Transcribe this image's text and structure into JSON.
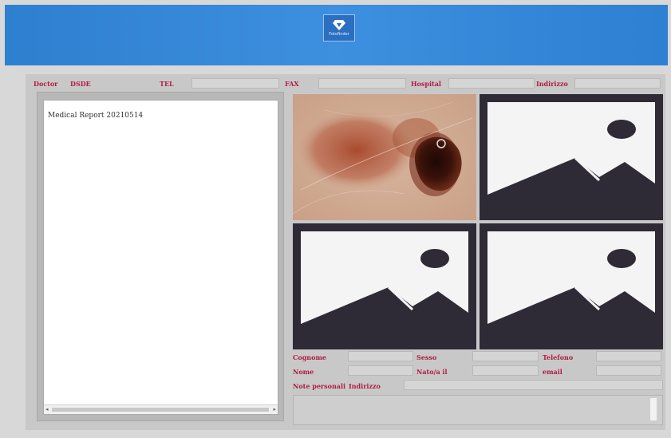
{
  "header": {
    "logo_caption": "Fotofinder"
  },
  "doctor_bar": {
    "doctor_label": "Doctor",
    "doctor_value": "DSDE",
    "tel_label": "TEL",
    "fax_label": "FAX",
    "hospital_label": "Hospital",
    "address_label": "Indirizzo"
  },
  "report": {
    "text": "Medical Report 20210514"
  },
  "images": [
    {
      "kind": "dermoscopy-photo"
    },
    {
      "kind": "placeholder-image"
    },
    {
      "kind": "placeholder-image"
    },
    {
      "kind": "placeholder-image"
    }
  ],
  "patient": {
    "cognome_label": "Cognome",
    "sesso_label": "Sesso",
    "telefono_label": "Telefono",
    "nome_label": "Nome",
    "nato_label": "Nato/a il",
    "email_label": "email",
    "note_label": "Note personali",
    "indirizzo_label": "Indirizzo"
  },
  "colors": {
    "header": "#3a8ad9",
    "label": "#b01c44",
    "panel": "#c9c8c8"
  }
}
